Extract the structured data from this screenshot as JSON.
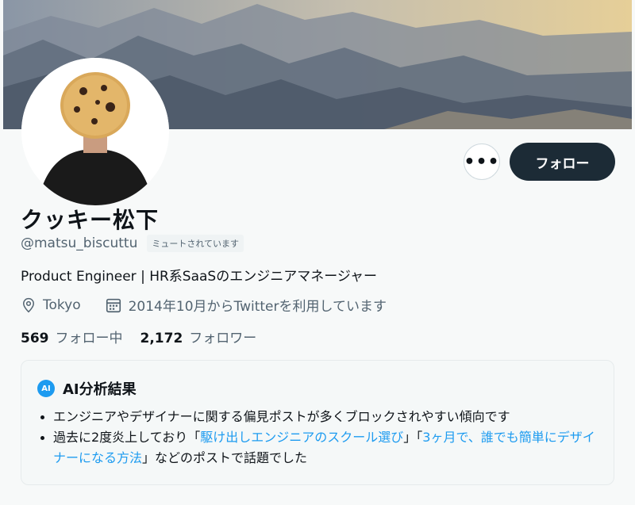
{
  "profile": {
    "display_name": "クッキー松下",
    "handle": "@matsu_biscuttu",
    "muted_badge": "ミュートされています",
    "bio": "Product Engineer | HR系SaaSのエンジニアマネージャー",
    "location": "Tokyo",
    "joined": "2014年10月からTwitterを利用しています"
  },
  "actions": {
    "more_label": "•••",
    "follow_label": "フォロー"
  },
  "stats": {
    "following_count": "569",
    "following_label": "フォロー中",
    "followers_count": "2,172",
    "followers_label": "フォロワー"
  },
  "ai_analysis": {
    "badge": "AI",
    "title": "AI分析結果",
    "item1": "エンジニアやデザイナーに関する偏見ポストが多くブロックされやすい傾向です",
    "item2_prefix": "過去に2度炎上しており「",
    "item2_link1": "駆け出しエンジニアのスクール選び",
    "item2_middle": "」「",
    "item2_link2": "3ヶ月で、誰でも簡単にデザイナーになる方法",
    "item2_suffix": "」などのポストで話題でした"
  },
  "icons": {
    "location": "location-pin-icon",
    "calendar": "calendar-icon"
  },
  "colors": {
    "accent": "#1d9bf0",
    "follow_button": "#1c2b36",
    "secondary_text": "#536471"
  }
}
